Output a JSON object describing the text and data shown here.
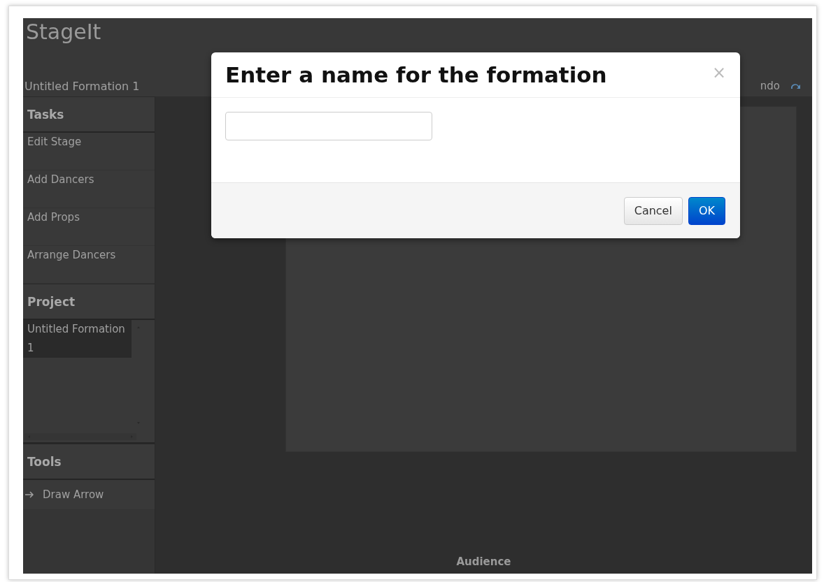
{
  "app": {
    "logo": "StageIt",
    "formation_title": "Untitled Formation 1",
    "undo_label": "ndo"
  },
  "sidebar": {
    "sections": [
      {
        "title": "Tasks",
        "kind": "list",
        "items": [
          {
            "label": "Edit Stage"
          },
          {
            "label": "Add Dancers"
          },
          {
            "label": "Add Props"
          },
          {
            "label": "Arrange Dancers"
          }
        ]
      },
      {
        "title": "Project",
        "kind": "scroll-list",
        "items": [
          {
            "label": "Untitled Formation 1",
            "selected": true
          }
        ]
      },
      {
        "title": "Tools",
        "kind": "tools",
        "items": [
          {
            "label": "Draw Arrow"
          }
        ]
      }
    ]
  },
  "stage": {
    "audience_label": "Audience"
  },
  "dialog": {
    "title": "Enter a name for the formation",
    "close": "×",
    "buttons": [
      {
        "label": "Cancel",
        "kind": "secondary"
      },
      {
        "label": "OK",
        "kind": "primary"
      }
    ]
  }
}
